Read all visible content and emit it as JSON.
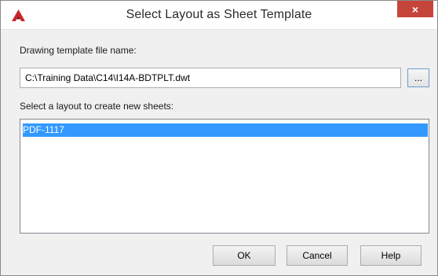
{
  "window": {
    "title": "Select Layout as Sheet Template",
    "app_icon": "autocad-logo-icon",
    "close_label": "×",
    "accent_color": "#c7443a"
  },
  "template": {
    "label": "Drawing template file name:",
    "value": "C:\\Training Data\\C14\\I14A-BDTPLT.dwt",
    "browse_label": "..."
  },
  "layouts": {
    "label": "Select a layout to create new sheets:",
    "items": [
      {
        "label": "PDF-1117",
        "selected": true
      }
    ],
    "selection_color": "#3399ff"
  },
  "buttons": {
    "ok_label": "OK",
    "cancel_label": "Cancel",
    "help_label": "Help"
  }
}
